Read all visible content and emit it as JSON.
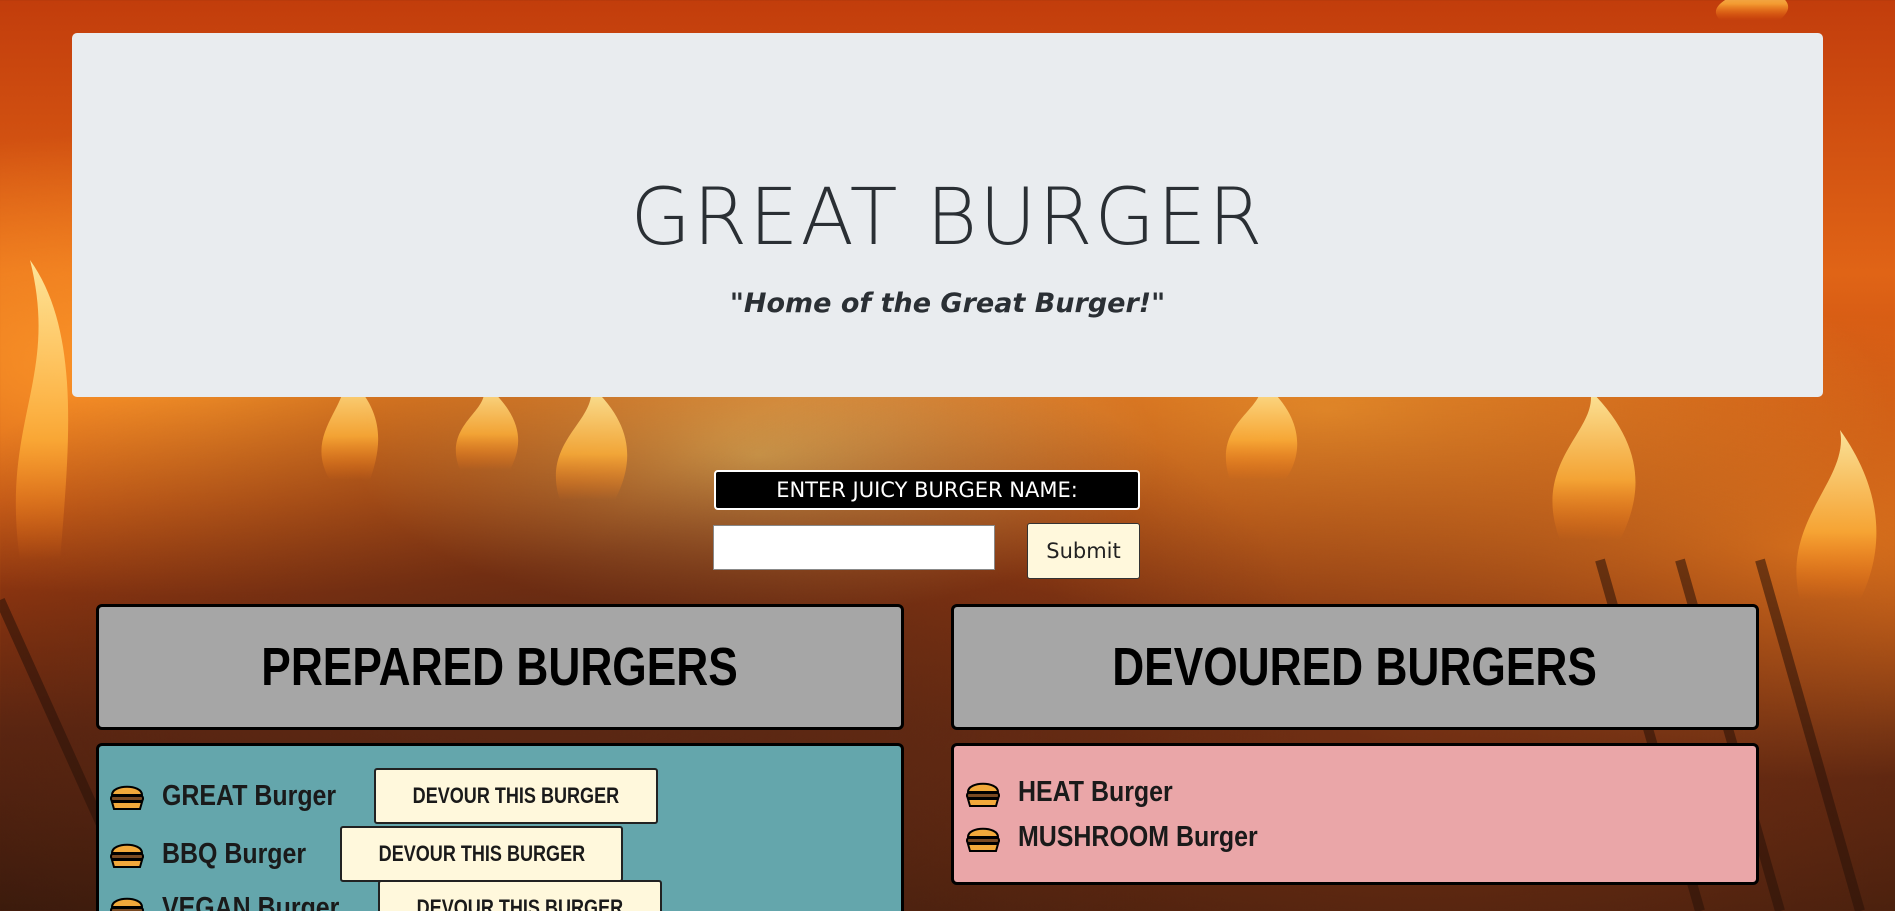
{
  "header": {
    "title": "GREAT BURGER",
    "tagline": "\"Home of the Great Burger!\""
  },
  "form": {
    "label": "ENTER JUICY BURGER NAME:",
    "input_value": "",
    "submit_label": "Submit"
  },
  "prepared": {
    "heading": "PREPARED BURGERS",
    "items": [
      {
        "name": "GREAT Burger",
        "button": "DEVOUR THIS BURGER"
      },
      {
        "name": "BBQ Burger",
        "button": "DEVOUR THIS BURGER"
      },
      {
        "name": "VEGAN Burger",
        "button": "DEVOUR THIS BURGER"
      }
    ]
  },
  "devoured": {
    "heading": "DEVOURED BURGERS",
    "items": [
      {
        "name": "HEAT Burger"
      },
      {
        "name": "MUSHROOM Burger"
      }
    ]
  },
  "icons": {
    "burger": "hamburger-icon"
  },
  "colors": {
    "prepared_panel": "#64a6ac",
    "devoured_panel": "#eaa6a8",
    "heading_panel": "#a6a6a6",
    "button_bg": "#fff8dc"
  }
}
